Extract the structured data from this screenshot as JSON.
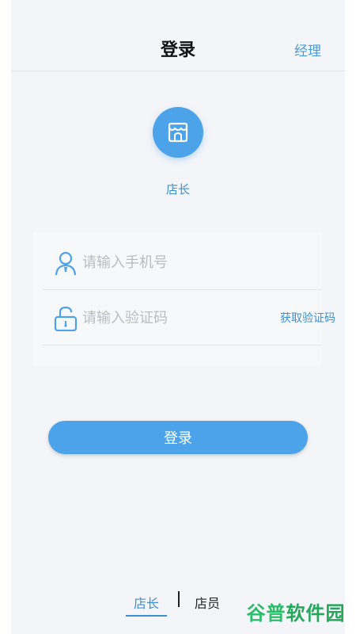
{
  "navbar": {
    "title": "登录",
    "right_link": "经理"
  },
  "role": {
    "label": "店长",
    "icon": "store-icon",
    "color": "#4ca3ea"
  },
  "form": {
    "phone_placeholder": "请输入手机号",
    "phone_icon": "user-icon",
    "code_placeholder": "请输入验证码",
    "code_icon": "unlock-icon",
    "get_code_label": "获取验证码"
  },
  "login_button": {
    "label": "登录"
  },
  "tabs": [
    {
      "label": "店长",
      "active": true
    },
    {
      "label": "店员",
      "active": false
    }
  ],
  "watermark": {
    "part1": "谷普",
    "part2": "软件园"
  },
  "colors": {
    "accent": "#4ca3ea",
    "link": "#3e8fcf",
    "background": "#f4f5f8"
  }
}
